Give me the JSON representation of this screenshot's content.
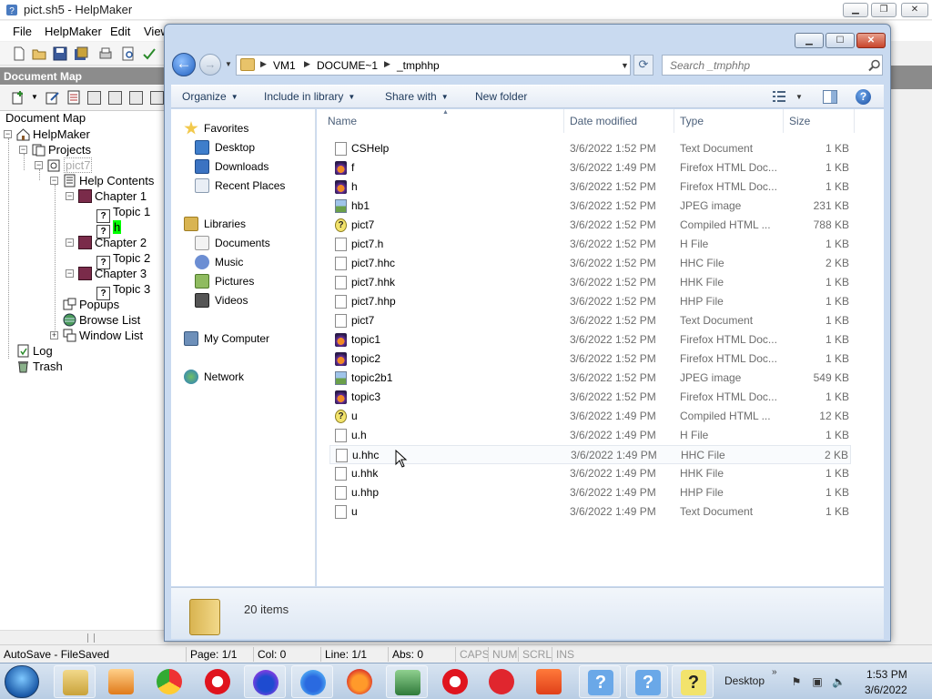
{
  "helpmaker": {
    "title": "pict.sh5 - HelpMaker",
    "menu": [
      "File",
      "HelpMaker",
      "Edit",
      "View"
    ],
    "docmap": {
      "header": "Document Map",
      "label": "Document Map",
      "tree": [
        {
          "label": "HelpMaker",
          "icon": "home-icon"
        },
        {
          "label": "Projects",
          "icon": "projects-icon"
        },
        {
          "label": "pict7",
          "icon": "project-icon"
        },
        {
          "label": "Help Contents",
          "icon": "contents-icon"
        },
        {
          "label": "Chapter 1",
          "icon": "book-icon"
        },
        {
          "label": "Topic 1",
          "icon": "topic-icon"
        },
        {
          "label": "h",
          "icon": "topic-icon"
        },
        {
          "label": "Chapter 2",
          "icon": "book-icon"
        },
        {
          "label": "Topic 2",
          "icon": "topic-icon"
        },
        {
          "label": "Chapter 3",
          "icon": "book-icon"
        },
        {
          "label": "Topic 3",
          "icon": "topic-icon"
        },
        {
          "label": "Popups",
          "icon": "popups-icon"
        },
        {
          "label": "Browse List",
          "icon": "globe-icon"
        },
        {
          "label": "Window List",
          "icon": "window-list-icon"
        },
        {
          "label": "Log",
          "icon": "log-icon"
        },
        {
          "label": "Trash",
          "icon": "trash-icon"
        }
      ]
    },
    "status": {
      "autosave": "AutoSave - FileSaved",
      "page": "Page: 1/1",
      "col": "Col: 0",
      "line": "Line: 1/1",
      "abs": "Abs: 0",
      "caps": "CAPS",
      "num": "NUM",
      "scrl": "SCRL",
      "ins": "INS"
    }
  },
  "explorer": {
    "address": [
      "VM1",
      "DOCUME~1",
      "_tmphhp"
    ],
    "search_placeholder": "Search _tmphhp",
    "commands": {
      "organize": "Organize",
      "include": "Include in library",
      "share": "Share with",
      "new_folder": "New folder"
    },
    "nav": {
      "favorites": "Favorites",
      "desktop": "Desktop",
      "downloads": "Downloads",
      "recent": "Recent Places",
      "libraries": "Libraries",
      "documents": "Documents",
      "music": "Music",
      "pictures": "Pictures",
      "videos": "Videos",
      "computer": "My Computer",
      "network": "Network"
    },
    "columns": {
      "name": "Name",
      "date": "Date modified",
      "type": "Type",
      "size": "Size"
    },
    "files": [
      {
        "name": "CSHelp",
        "date": "3/6/2022 1:52 PM",
        "type": "Text Document",
        "size": "1 KB",
        "icon": "text-file-icon"
      },
      {
        "name": "f",
        "date": "3/6/2022 1:49 PM",
        "type": "Firefox HTML Doc...",
        "size": "1 KB",
        "icon": "firefox-html-icon"
      },
      {
        "name": "h",
        "date": "3/6/2022 1:52 PM",
        "type": "Firefox HTML Doc...",
        "size": "1 KB",
        "icon": "firefox-html-icon"
      },
      {
        "name": "hb1",
        "date": "3/6/2022 1:52 PM",
        "type": "JPEG image",
        "size": "231 KB",
        "icon": "jpeg-icon"
      },
      {
        "name": "pict7",
        "date": "3/6/2022 1:52 PM",
        "type": "Compiled HTML ...",
        "size": "788 KB",
        "icon": "chm-icon"
      },
      {
        "name": "pict7.h",
        "date": "3/6/2022 1:52 PM",
        "type": "H File",
        "size": "1 KB",
        "icon": "file-icon"
      },
      {
        "name": "pict7.hhc",
        "date": "3/6/2022 1:52 PM",
        "type": "HHC File",
        "size": "2 KB",
        "icon": "file-icon"
      },
      {
        "name": "pict7.hhk",
        "date": "3/6/2022 1:52 PM",
        "type": "HHK File",
        "size": "1 KB",
        "icon": "file-icon"
      },
      {
        "name": "pict7.hhp",
        "date": "3/6/2022 1:52 PM",
        "type": "HHP File",
        "size": "1 KB",
        "icon": "file-icon"
      },
      {
        "name": "pict7",
        "date": "3/6/2022 1:52 PM",
        "type": "Text Document",
        "size": "1 KB",
        "icon": "text-file-icon"
      },
      {
        "name": "topic1",
        "date": "3/6/2022 1:52 PM",
        "type": "Firefox HTML Doc...",
        "size": "1 KB",
        "icon": "firefox-html-icon"
      },
      {
        "name": "topic2",
        "date": "3/6/2022 1:52 PM",
        "type": "Firefox HTML Doc...",
        "size": "1 KB",
        "icon": "firefox-html-icon"
      },
      {
        "name": "topic2b1",
        "date": "3/6/2022 1:52 PM",
        "type": "JPEG image",
        "size": "549 KB",
        "icon": "jpeg-icon"
      },
      {
        "name": "topic3",
        "date": "3/6/2022 1:52 PM",
        "type": "Firefox HTML Doc...",
        "size": "1 KB",
        "icon": "firefox-html-icon"
      },
      {
        "name": "u",
        "date": "3/6/2022 1:49 PM",
        "type": "Compiled HTML ...",
        "size": "12 KB",
        "icon": "chm-icon"
      },
      {
        "name": "u.h",
        "date": "3/6/2022 1:49 PM",
        "type": "H File",
        "size": "1 KB",
        "icon": "file-icon"
      },
      {
        "name": "u.hhc",
        "date": "3/6/2022 1:49 PM",
        "type": "HHC File",
        "size": "2 KB",
        "icon": "file-icon"
      },
      {
        "name": "u.hhk",
        "date": "3/6/2022 1:49 PM",
        "type": "HHK File",
        "size": "1 KB",
        "icon": "file-icon"
      },
      {
        "name": "u.hhp",
        "date": "3/6/2022 1:49 PM",
        "type": "HHP File",
        "size": "1 KB",
        "icon": "file-icon"
      },
      {
        "name": "u",
        "date": "3/6/2022 1:49 PM",
        "type": "Text Document",
        "size": "1 KB",
        "icon": "text-file-icon"
      }
    ],
    "item_count": "20 items"
  },
  "taskbar": {
    "desktop_label": "Desktop",
    "time": "1:53 PM",
    "date": "3/6/2022"
  },
  "colors": {
    "explorer_frame": "#c9daf0",
    "docmap_header": "#8c8c8c",
    "taskbar": "#b9cde4",
    "highlight_h": "#00ff00"
  }
}
